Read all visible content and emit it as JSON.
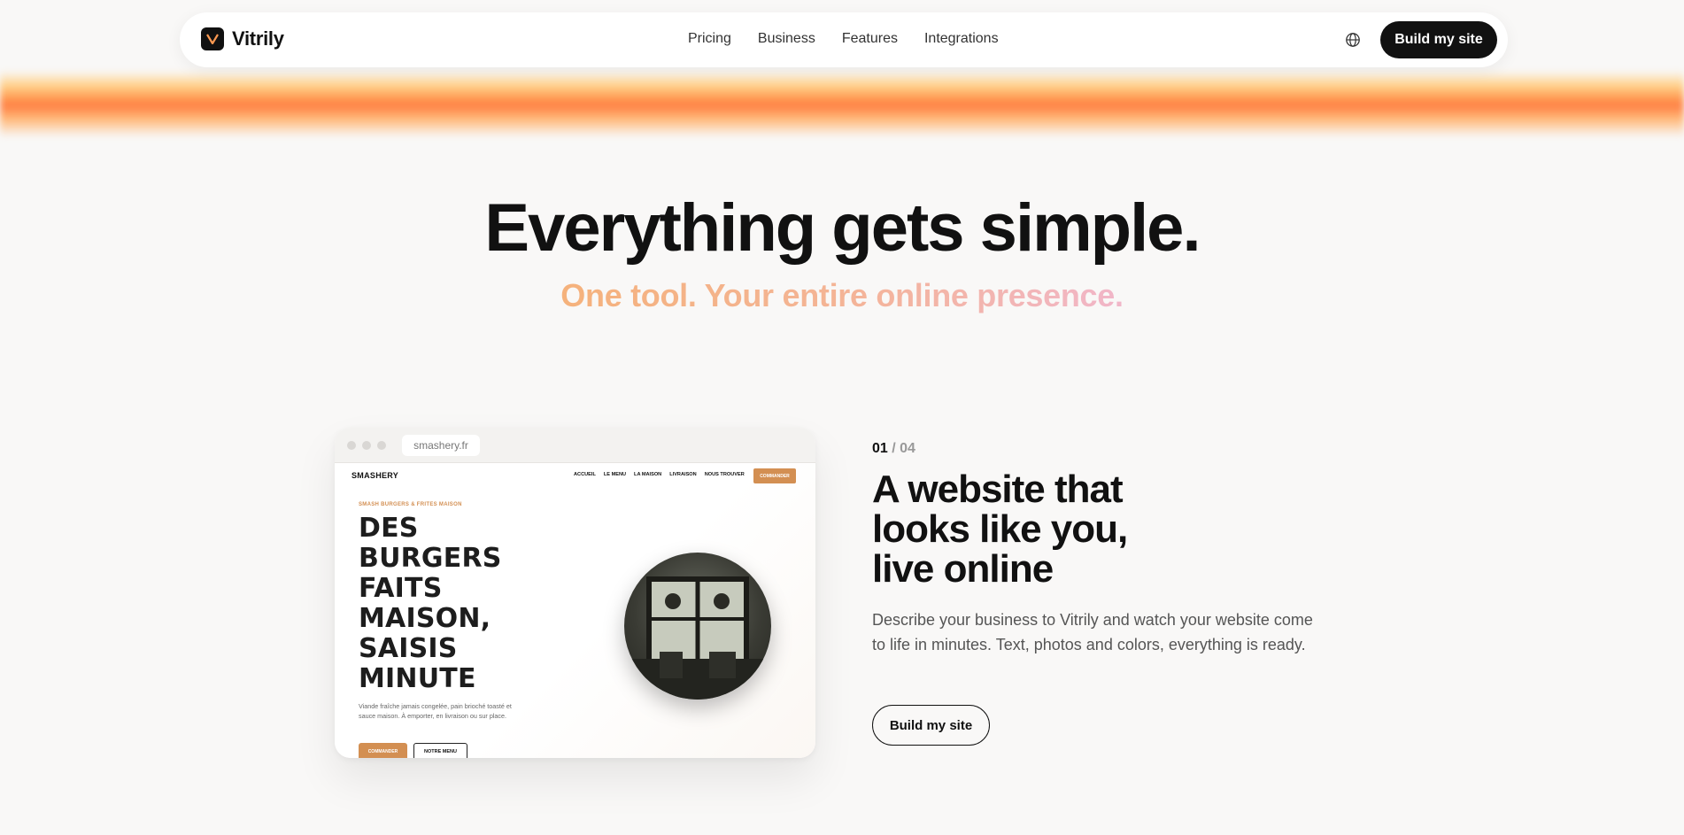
{
  "brand": {
    "name": "Vitrily",
    "logo_icon": "v-logo-icon"
  },
  "nav": {
    "items": [
      "Pricing",
      "Business",
      "Features",
      "Integrations"
    ],
    "language_icon": "globe-icon",
    "cta_label": "Build my site"
  },
  "hero": {
    "title": "Everything gets simple.",
    "tagline": "One tool. Your entire online presence."
  },
  "preview": {
    "url": "smashery.fr",
    "site": {
      "brand": "SMASHERY",
      "menu": [
        "ACCUEIL",
        "LE MENU",
        "LA MAISON",
        "LIVRAISON",
        "NOUS TROUVER"
      ],
      "order_label": "COMMANDER",
      "kicker": "SMASH BURGERS & FRITES MAISON",
      "headline": "DES BURGERS FAITS MAISON, SAISIS MINUTE",
      "description": "Viande fraîche jamais congelée, pain brioché toasté et sauce maison. À emporter, en livraison ou sur place.",
      "primary_button": "COMMANDER",
      "secondary_button": "NOTRE MENU"
    }
  },
  "feature": {
    "step_current": "01",
    "step_separator": "/",
    "step_total": "04",
    "title_line1": "A website that",
    "title_line2": "looks like you,",
    "title_line3": "live online",
    "description": "Describe your business to Vitrily and watch your website come to life in minutes. Text, photos and colors, everything is ready.",
    "cta_label": "Build my site"
  },
  "colors": {
    "accent": "#d38f52",
    "dark": "#111111",
    "glow": "#ff7f44"
  }
}
